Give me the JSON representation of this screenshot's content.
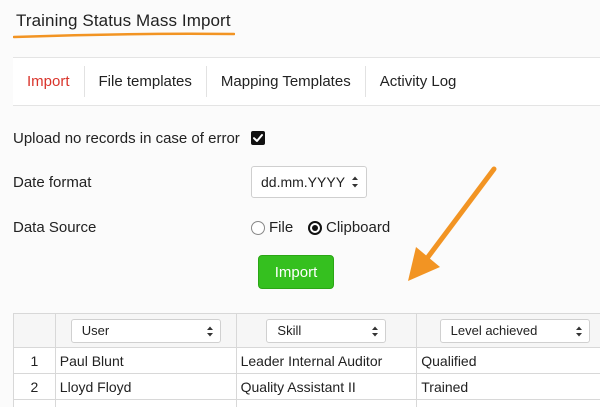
{
  "page": {
    "title": "Training Status Mass Import"
  },
  "tabs": [
    {
      "label": "Import",
      "active": true
    },
    {
      "label": "File templates",
      "active": false
    },
    {
      "label": "Mapping Templates",
      "active": false
    },
    {
      "label": "Activity Log",
      "active": false
    }
  ],
  "form": {
    "upload_error_label": "Upload no records in case of error",
    "upload_error_checked": true,
    "date_format_label": "Date format",
    "date_format_value": "dd.mm.YYYY",
    "data_source_label": "Data Source",
    "data_source_options": [
      {
        "label": "File",
        "checked": false
      },
      {
        "label": "Clipboard",
        "checked": true
      }
    ],
    "import_button": "Import"
  },
  "grid": {
    "columns": [
      "User",
      "Skill",
      "Level achieved"
    ],
    "rows": [
      {
        "num": "1",
        "user": "Paul Blunt",
        "skill": "Leader Internal Auditor",
        "level": "Qualified"
      },
      {
        "num": "2",
        "user": "Lloyd Floyd",
        "skill": "Quality Assistant II",
        "level": "Trained"
      }
    ]
  },
  "colors": {
    "accent": "#f29423",
    "active_tab": "#d9342b",
    "import_button": "#35c01f"
  }
}
